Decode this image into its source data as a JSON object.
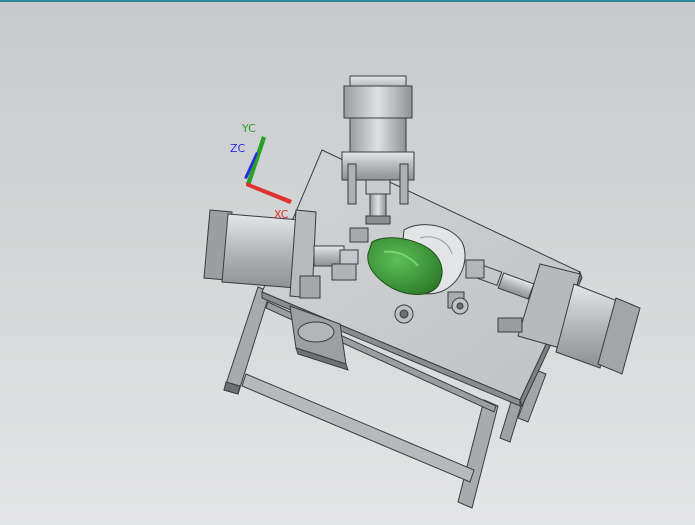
{
  "viewport": {
    "background_top": "#c7c9cb",
    "background_bottom": "#e4e5e6",
    "border_color": "#2b8a9a"
  },
  "triad": {
    "x_label": "XC",
    "y_label": "YC",
    "z_label": "ZC",
    "x_color": "#e03030",
    "y_color": "#2aa02a",
    "z_color": "#2a2ae0"
  },
  "model": {
    "part_color": "#3f9e3a",
    "metal_color": "#b9bcbf"
  }
}
